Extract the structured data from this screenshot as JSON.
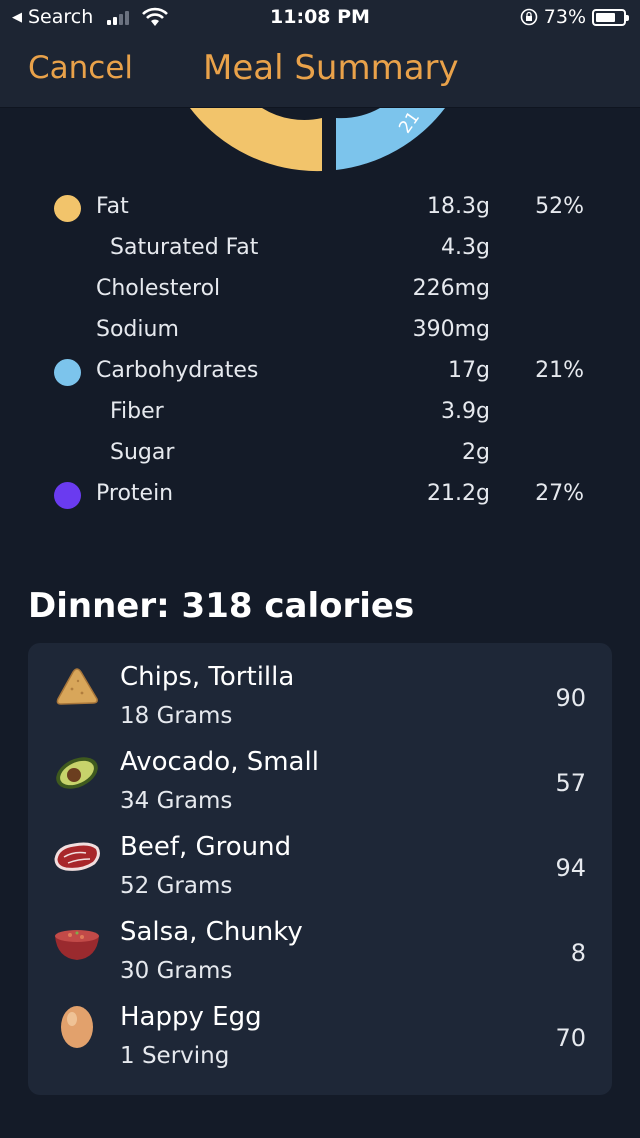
{
  "status_bar": {
    "back_label": "Search",
    "time": "11:08 PM",
    "battery": "73%",
    "battery_level": 0.73
  },
  "header": {
    "cancel_label": "Cancel",
    "title": "Meal Summary"
  },
  "donut": {
    "visible_label": "21",
    "colors": {
      "fat": "#f2c46b",
      "carbohydrates": "#7cc4ec",
      "protein": "#6a3bf0"
    }
  },
  "nutrients": [
    {
      "label": "Fat",
      "amount": "18.3g",
      "percent": "52%",
      "dot_color": "#f2c46b"
    },
    {
      "label": "Saturated Fat",
      "amount": "4.3g",
      "percent": ""
    },
    {
      "label": "Cholesterol",
      "amount": "226mg",
      "percent": ""
    },
    {
      "label": "Sodium",
      "amount": "390mg",
      "percent": ""
    },
    {
      "label": "Carbohydrates",
      "amount": "17g",
      "percent": "21%",
      "dot_color": "#7cc4ec"
    },
    {
      "label": "Fiber",
      "amount": "3.9g",
      "percent": ""
    },
    {
      "label": "Sugar",
      "amount": "2g",
      "percent": ""
    },
    {
      "label": "Protein",
      "amount": "21.2g",
      "percent": "27%",
      "dot_color": "#6a3bf0"
    }
  ],
  "dinner": {
    "title": "Dinner: 318 calories",
    "items": [
      {
        "name": "Chips, Tortilla",
        "quantity": "18 Grams",
        "calories": "90",
        "icon": "tortilla-chip-icon"
      },
      {
        "name": "Avocado, Small",
        "quantity": "34 Grams",
        "calories": "57",
        "icon": "avocado-icon"
      },
      {
        "name": "Beef, Ground",
        "quantity": "52 Grams",
        "calories": "94",
        "icon": "steak-icon"
      },
      {
        "name": "Salsa, Chunky",
        "quantity": "30 Grams",
        "calories": "8",
        "icon": "salsa-bowl-icon"
      },
      {
        "name": "Happy Egg",
        "quantity": "1 Serving",
        "calories": "70",
        "icon": "egg-icon"
      }
    ]
  }
}
